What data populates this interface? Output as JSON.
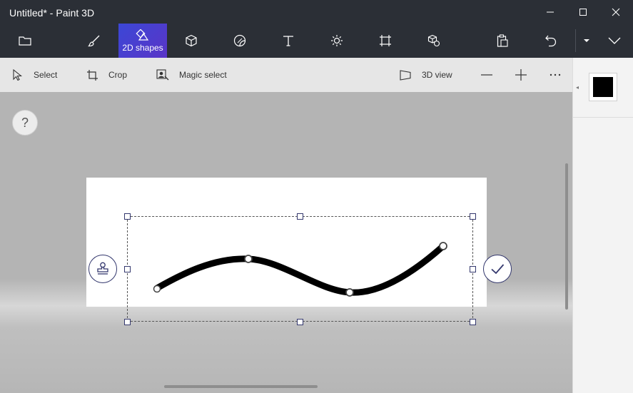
{
  "window": {
    "title": "Untitled* - Paint 3D",
    "controls": [
      "minimize-icon",
      "maximize-icon",
      "close-icon"
    ]
  },
  "ribbon": {
    "items": [
      {
        "name": "menu",
        "icon": "folder-icon",
        "label": ""
      },
      {
        "name": "brushes",
        "icon": "brush-icon",
        "label": ""
      },
      {
        "name": "2d-shapes",
        "icon": "shapes-icon",
        "label": "2D shapes",
        "active": true
      },
      {
        "name": "3d-shapes",
        "icon": "cube-icon",
        "label": ""
      },
      {
        "name": "stickers",
        "icon": "sticker-icon",
        "label": ""
      },
      {
        "name": "text",
        "icon": "text-icon",
        "label": ""
      },
      {
        "name": "effects",
        "icon": "sun-icon",
        "label": ""
      },
      {
        "name": "canvas",
        "icon": "canvas-icon",
        "label": ""
      },
      {
        "name": "3d-library",
        "icon": "library-icon",
        "label": ""
      },
      {
        "name": "paste",
        "icon": "paste-icon",
        "label": ""
      },
      {
        "name": "undo",
        "icon": "undo-icon",
        "label": ""
      },
      {
        "name": "history",
        "icon": "chevron-down-small-icon",
        "label": ""
      },
      {
        "name": "expand",
        "icon": "chevron-down-icon",
        "label": ""
      }
    ],
    "active_color": "#3d46d4"
  },
  "toolbar": {
    "select_label": "Select",
    "crop_label": "Crop",
    "magic_select_label": "Magic select",
    "view_3d_label": "3D view",
    "zoom_out_icon": "minus-icon",
    "zoom_in_icon": "plus-icon",
    "more_icon": "ellipsis-icon"
  },
  "workspace": {
    "help_label": "?",
    "canvas_color": "#ffffff",
    "stroke_color": "#000000",
    "stamp_icon": "stamp-icon",
    "confirm_icon": "checkmark-icon"
  },
  "panel": {
    "collapse_glyph": "◂",
    "selected_color": "#000000"
  }
}
